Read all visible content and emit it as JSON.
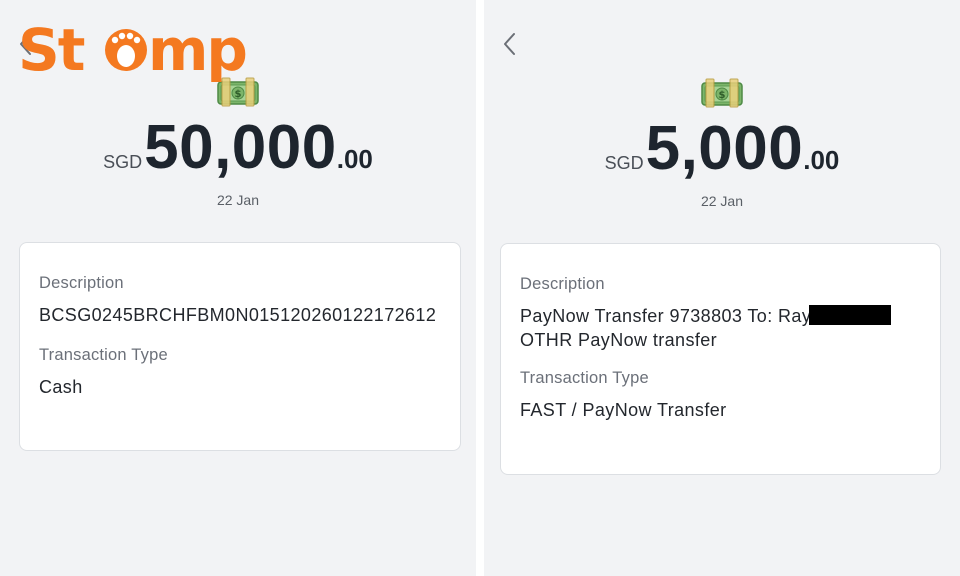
{
  "logo": {
    "text": "Stomp",
    "color": "#f47920"
  },
  "left": {
    "currency": "SGD",
    "amount_whole": "50,000",
    "amount_cents": ".00",
    "date": "22 Jan",
    "description_label": "Description",
    "description_value": "BCSG0245BRCHFBM0N015120260122172612",
    "type_label": "Transaction Type",
    "type_value": "Cash",
    "icons": {
      "back": "chevron-left-icon",
      "money": "money-bag-icon"
    }
  },
  "right": {
    "currency": "SGD",
    "amount_whole": "5,000",
    "amount_cents": ".00",
    "date": "22 Jan",
    "description_label": "Description",
    "description_line1": "PayNow Transfer 9738803 To: Ray",
    "description_line2": "OTHR PayNow transfer",
    "type_label": "Transaction Type",
    "type_value": "FAST / PayNow Transfer",
    "icons": {
      "back": "chevron-left-icon",
      "money": "money-bag-icon"
    }
  },
  "colors": {
    "panel_bg": "#f2f3f5",
    "card_bg": "#ffffff",
    "amount_text": "#1e252e",
    "label_text": "#6b7079",
    "redaction": "#000000"
  }
}
